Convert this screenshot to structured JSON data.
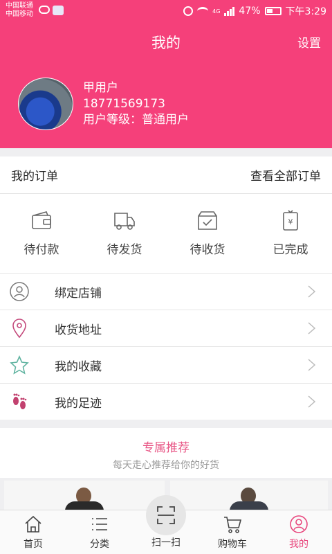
{
  "status_bar": {
    "carrier_1": "中国联通",
    "carrier_2": "中国移动",
    "network": "4G",
    "battery": "47%",
    "time": "下午3:29"
  },
  "header": {
    "title": "我的",
    "settings": "设置",
    "user_name": "甲用户",
    "phone": "18771569173",
    "level": "用户等级：普通用户"
  },
  "orders": {
    "title": "我的订单",
    "view_all": "查看全部订单",
    "statuses": [
      {
        "label": "待付款",
        "icon": "wallet-icon"
      },
      {
        "label": "待发货",
        "icon": "truck-icon"
      },
      {
        "label": "待收货",
        "icon": "box-icon"
      },
      {
        "label": "已完成",
        "icon": "receipt-icon"
      }
    ]
  },
  "menu": {
    "items": [
      {
        "label": "绑定店铺",
        "icon": "user-icon"
      },
      {
        "label": "收货地址",
        "icon": "location-icon"
      },
      {
        "label": "我的收藏",
        "icon": "star-icon"
      },
      {
        "label": "我的足迹",
        "icon": "footprint-icon"
      }
    ]
  },
  "recommend": {
    "title": "专属推荐",
    "subtitle": "每天走心推荐给你的好货"
  },
  "nav": {
    "items": [
      {
        "label": "首页",
        "icon": "home-icon"
      },
      {
        "label": "分类",
        "icon": "list-icon"
      },
      {
        "label": "扫一扫",
        "icon": "scan-icon"
      },
      {
        "label": "购物车",
        "icon": "cart-icon"
      },
      {
        "label": "我的",
        "icon": "profile-icon"
      }
    ]
  },
  "colors": {
    "brand": "#f5407a",
    "accent": "#e8457c"
  }
}
